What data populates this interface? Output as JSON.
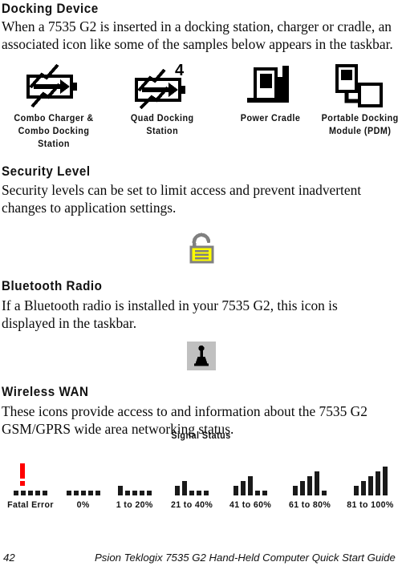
{
  "sections": {
    "docking": {
      "heading": "Docking Device",
      "paragraph": "When a 7535 G2 is inserted in a docking station, charger or cradle, an associated icon like some of the samples below appears in the taskbar.",
      "icons": [
        {
          "name": "combo-charger-icon",
          "caption_line1": "Combo Charger &",
          "caption_line2": "Combo Docking Station"
        },
        {
          "name": "quad-docking-icon",
          "caption_line1": "Quad Docking Station",
          "caption_line2": "",
          "badge": "4"
        },
        {
          "name": "power-cradle-icon",
          "caption_line1": "Power Cradle",
          "caption_line2": ""
        },
        {
          "name": "portable-docking-icon",
          "caption_line1": "Portable Docking",
          "caption_line2": "Module (PDM)"
        }
      ]
    },
    "security": {
      "heading": "Security Level",
      "paragraph": "Security levels can be set to limit access and prevent inadvertent changes to application settings.",
      "icon_name": "padlock-icon",
      "icon_body_color": "#ffff00",
      "icon_outline_color": "#808080"
    },
    "bluetooth": {
      "heading": "Bluetooth Radio",
      "paragraph": "If a Bluetooth radio is installed in your 7535 G2, this icon is displayed in the taskbar.",
      "icon_name": "bluetooth-radio-icon",
      "icon_background_color": "#c0c0c0",
      "icon_foreground_color": "#000000"
    },
    "wireless_wan": {
      "heading": "Wireless WAN",
      "paragraph": "These icons provide access to and information about the 7535 G2 GSM/GPRS wide area networking status.",
      "signal_status_label": "Signal Status",
      "error_color": "#ff0000",
      "bar_color": "#1a1a1a",
      "signal_levels": [
        {
          "label": "Fatal Error",
          "bars": [
            0,
            0,
            0,
            0,
            0
          ],
          "error_mark": true
        },
        {
          "label": "0%",
          "bars": [
            0,
            0,
            0,
            0,
            0
          ],
          "error_mark": false
        },
        {
          "label": "1 to 20%",
          "bars": [
            1,
            0,
            0,
            0,
            0
          ],
          "error_mark": false
        },
        {
          "label": "21 to 40%",
          "bars": [
            1,
            2,
            0,
            0,
            0
          ],
          "error_mark": false
        },
        {
          "label": "41 to 60%",
          "bars": [
            1,
            2,
            3,
            0,
            0
          ],
          "error_mark": false
        },
        {
          "label": "61 to 80%",
          "bars": [
            1,
            2,
            3,
            4,
            0
          ],
          "error_mark": false
        },
        {
          "label": "81 to 100%",
          "bars": [
            1,
            2,
            3,
            4,
            5
          ],
          "error_mark": false
        }
      ]
    }
  },
  "footer": {
    "page_number": "42",
    "title": "Psion Teklogix 7535 G2 Hand-Held Computer Quick Start Guide"
  }
}
